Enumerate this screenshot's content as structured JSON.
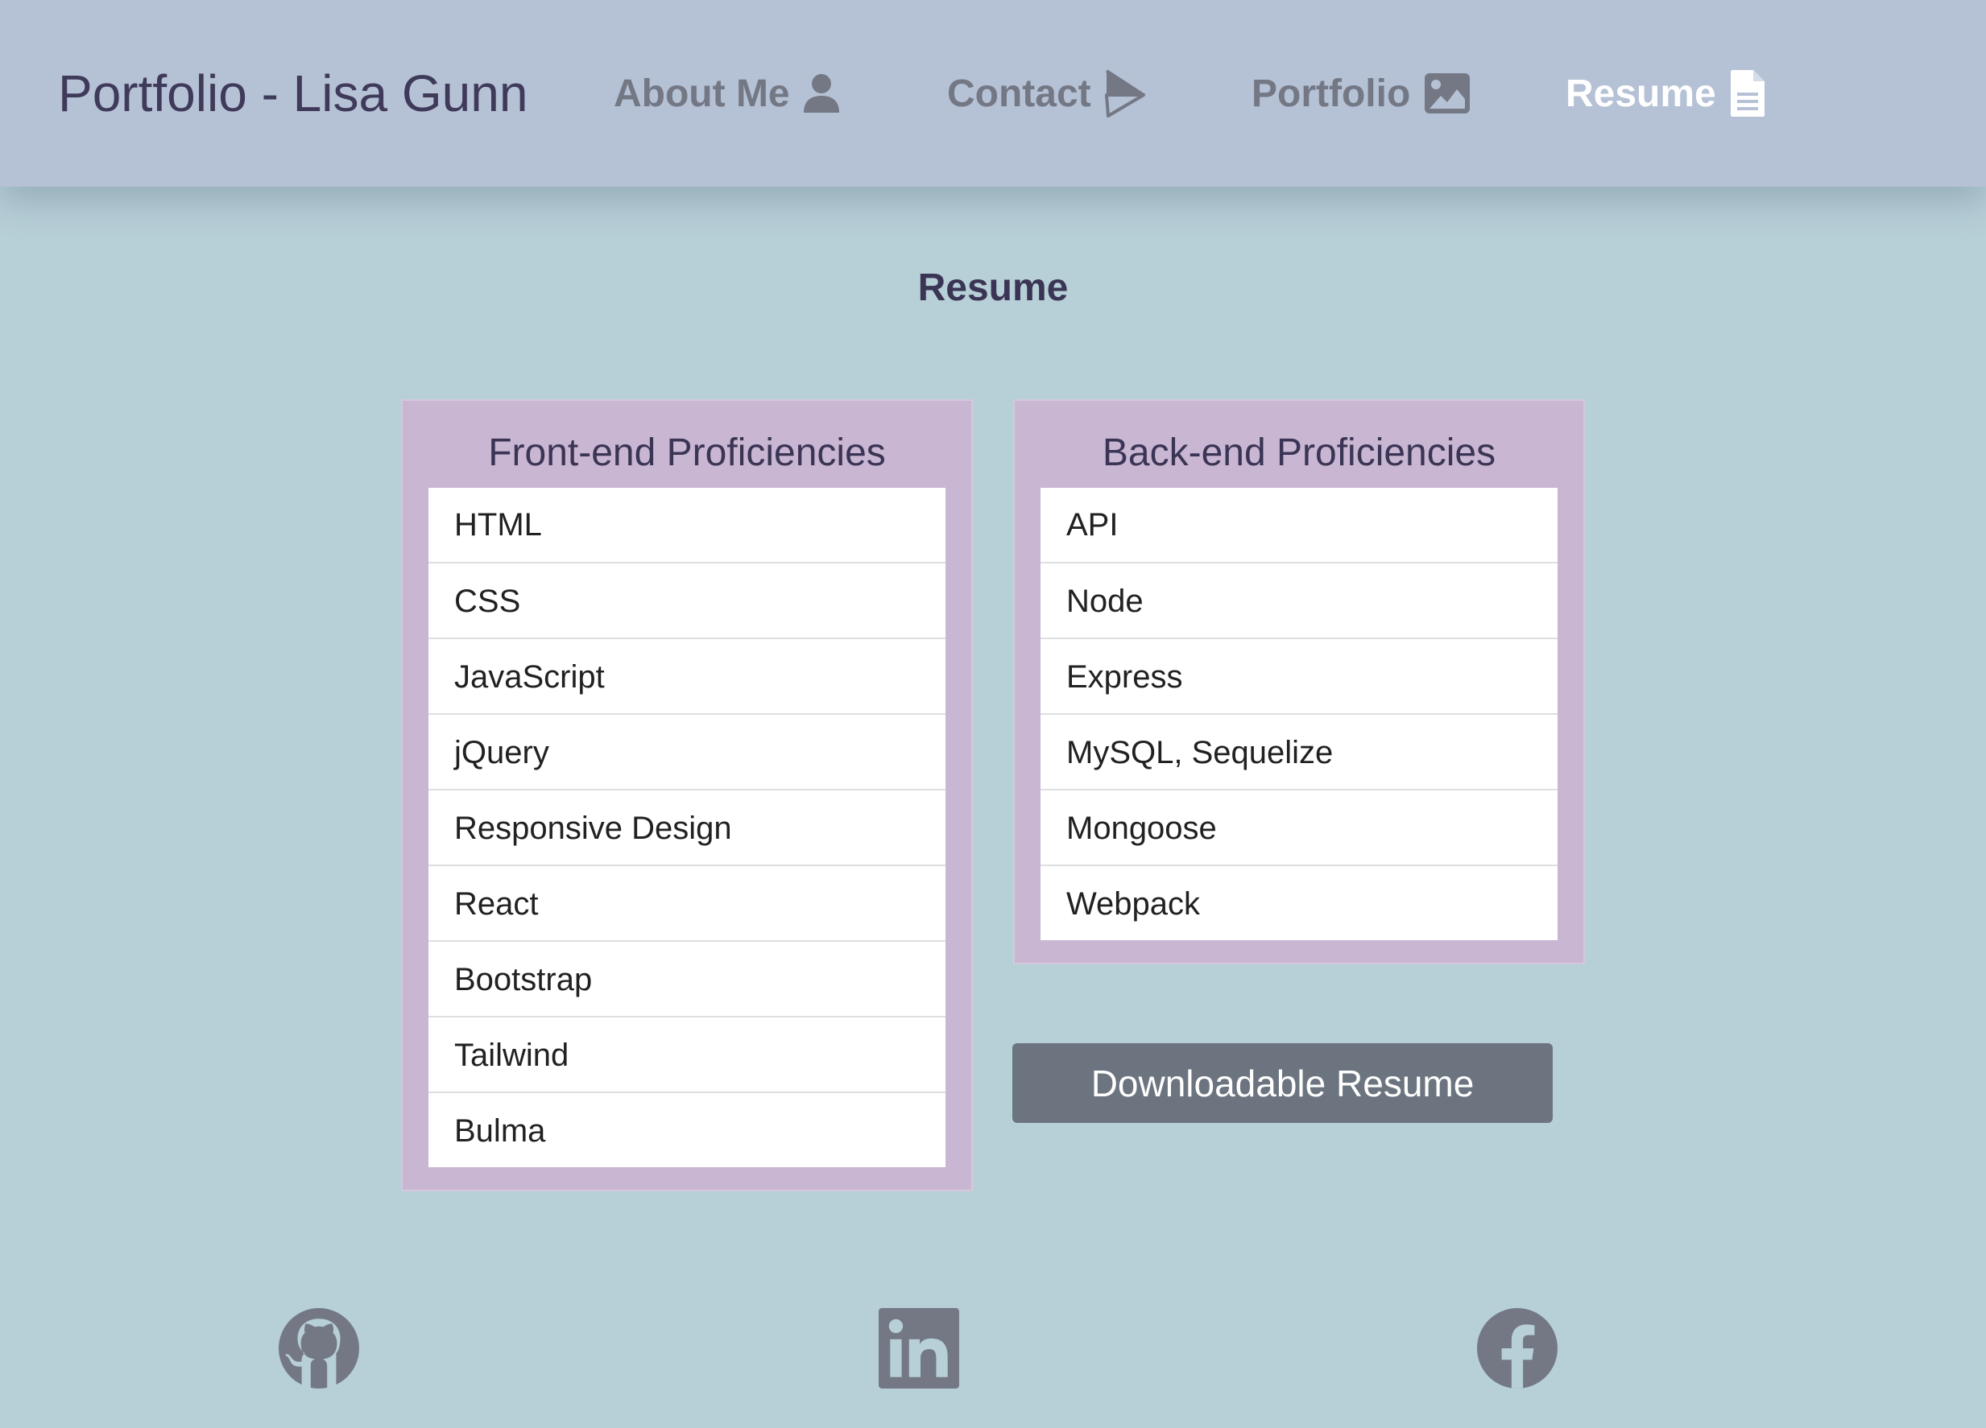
{
  "navbar": {
    "brand": "Portfolio - Lisa Gunn",
    "links": [
      {
        "label": "About Me",
        "icon": "user-icon"
      },
      {
        "label": "Contact",
        "icon": "paper-plane-icon"
      },
      {
        "label": "Portfolio",
        "icon": "image-icon"
      },
      {
        "label": "Resume",
        "icon": "file-icon",
        "active": true
      }
    ]
  },
  "page": {
    "title": "Resume"
  },
  "frontend": {
    "title": "Front-end Proficiencies",
    "items": [
      "HTML",
      "CSS",
      "JavaScript",
      "jQuery",
      "Responsive Design",
      "React",
      "Bootstrap",
      "Tailwind",
      "Bulma"
    ]
  },
  "backend": {
    "title": "Back-end Proficiencies",
    "items": [
      "API",
      "Node",
      "Express",
      "MySQL, Sequelize",
      "Mongoose",
      "Webpack"
    ]
  },
  "download": {
    "label": "Downloadable Resume"
  },
  "footer": {
    "icons": [
      "github-icon",
      "linkedin-icon",
      "facebook-icon"
    ]
  },
  "colors": {
    "background": "#b7cfd7",
    "navbar": "#b5c1d5",
    "card": "#c9b6d3",
    "button": "#6c757f",
    "nav_text": "#737884",
    "nav_active": "#ffffff",
    "heading": "#3b3555"
  }
}
